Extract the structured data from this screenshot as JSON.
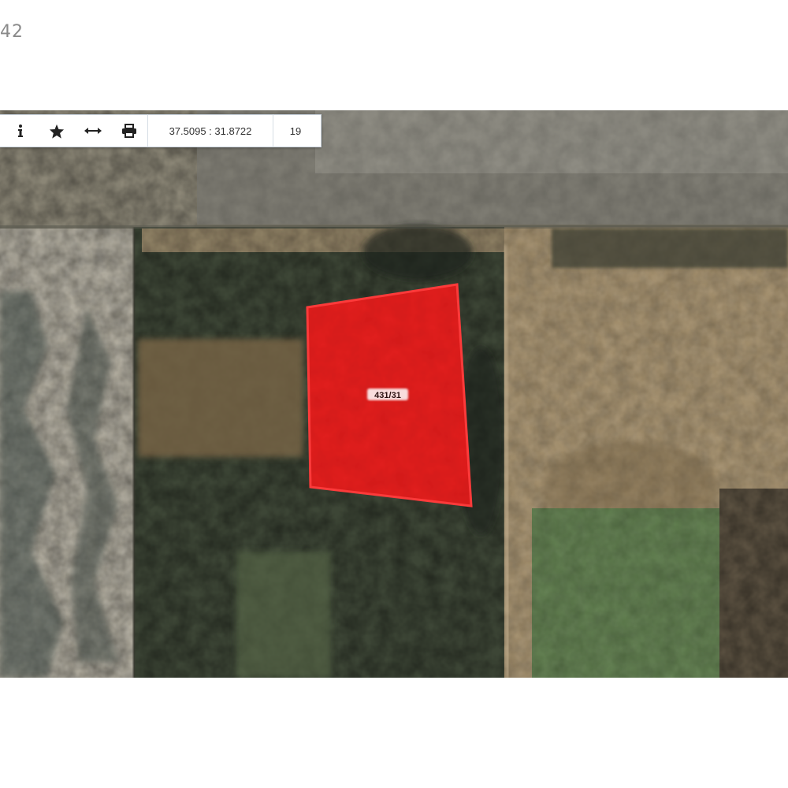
{
  "corner": {
    "text": "42"
  },
  "toolbar": {
    "info_icon": "info-icon",
    "favorite_icon": "star-icon",
    "measure_icon": "measure-arrows-icon",
    "print_icon": "printer-icon",
    "coordinates": "37.5095 : 31.8722",
    "zoom_level": "19"
  },
  "map": {
    "type": "satellite",
    "parcel": {
      "label": "431/31",
      "fill_color": "#f01818",
      "stroke_color": "#ff3030"
    }
  }
}
